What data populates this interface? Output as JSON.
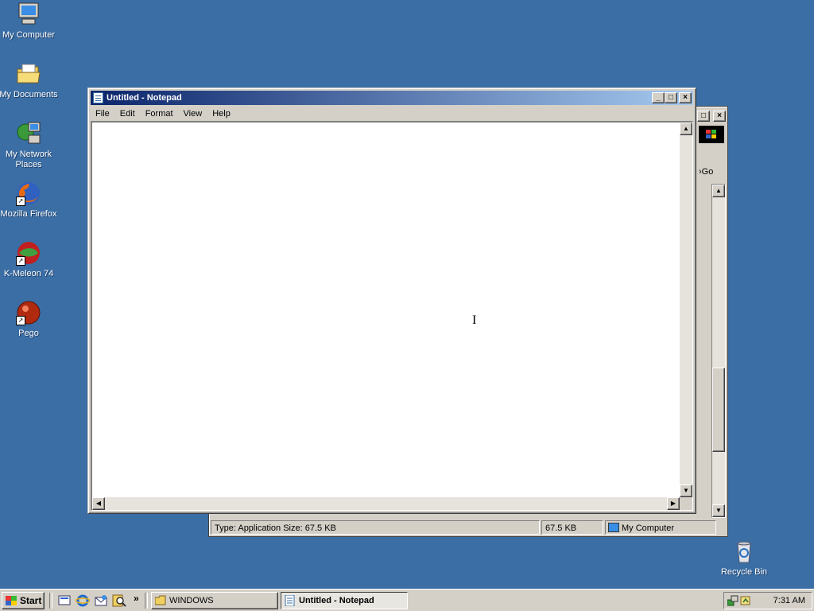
{
  "desktop": {
    "icons": [
      {
        "label": "My Computer",
        "icon": "my-computer-icon"
      },
      {
        "label": "My Documents",
        "icon": "my-documents-icon"
      },
      {
        "label": "My Network Places",
        "icon": "network-places-icon"
      },
      {
        "label": "Mozilla Firefox",
        "icon": "firefox-icon"
      },
      {
        "label": "K-Meleon 74",
        "icon": "kmeleon-icon"
      },
      {
        "label": "Pego",
        "icon": "pego-icon"
      },
      {
        "label": "Recycle Bin",
        "icon": "recycle-bin-icon"
      }
    ]
  },
  "background_window": {
    "go_label": "Go",
    "status": {
      "type_size": "Type: Application Size: 67.5 KB",
      "size": "67.5 KB",
      "zone": "My Computer"
    }
  },
  "notepad": {
    "title": "Untitled - Notepad",
    "menu": [
      "File",
      "Edit",
      "Format",
      "View",
      "Help"
    ],
    "content": "",
    "caption_buttons": {
      "minimize": "_",
      "maximize": "□",
      "close": "×"
    }
  },
  "taskbar": {
    "start_label": "Start",
    "quick_launch": [
      "show-desktop-icon",
      "internet-explorer-icon",
      "outlook-express-icon",
      "search-icon"
    ],
    "chevron": "»",
    "tasks": [
      {
        "label": "WINDOWS",
        "active": false
      },
      {
        "label": "Untitled - Notepad",
        "active": true
      }
    ],
    "clock": "7:31 AM"
  },
  "colors": {
    "desktop": "#3a6ea5",
    "titlebar_start": "#0a246a",
    "titlebar_end": "#a6caf0",
    "face": "#d4d0c8"
  }
}
